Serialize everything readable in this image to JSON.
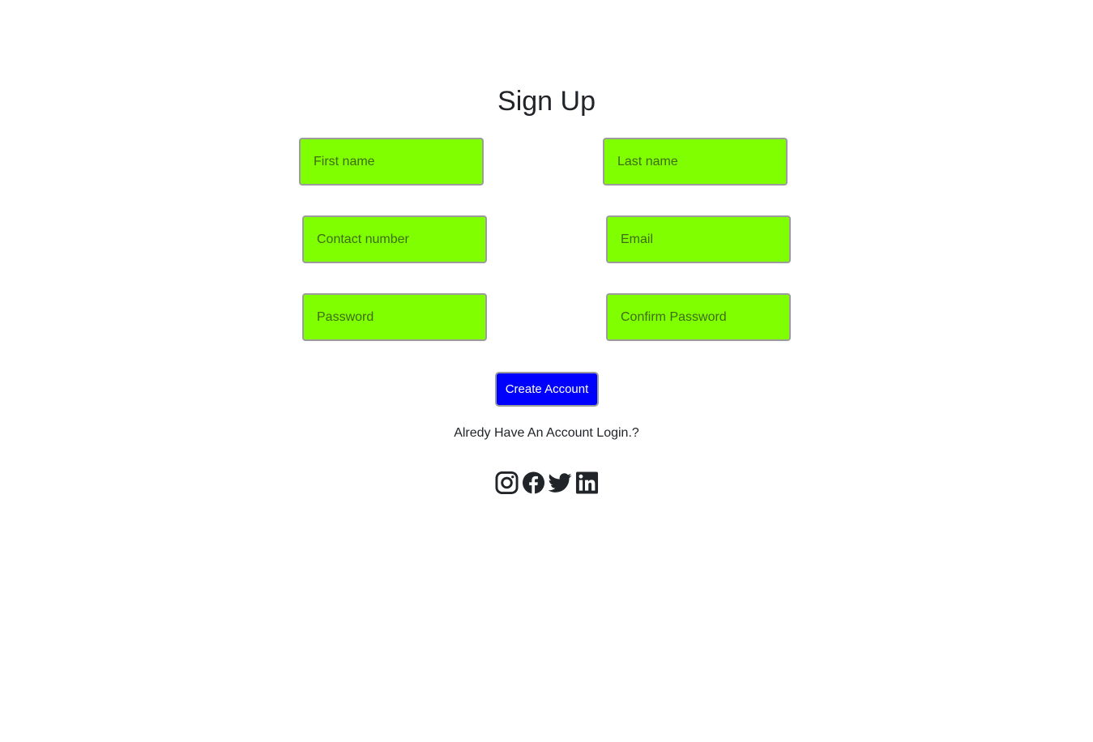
{
  "title": "Sign Up",
  "fields": {
    "first_name": {
      "placeholder": "First name",
      "value": ""
    },
    "last_name": {
      "placeholder": "Last name",
      "value": ""
    },
    "contact_number": {
      "placeholder": "Contact number",
      "value": ""
    },
    "email": {
      "placeholder": "Email",
      "value": ""
    },
    "password": {
      "placeholder": "Password",
      "value": ""
    },
    "confirm_password": {
      "placeholder": "Confirm Password",
      "value": ""
    }
  },
  "create_button_label": "Create Account",
  "login_link_text": "Alredy Have An Account Login.?",
  "social_icons": [
    "instagram-icon",
    "facebook-icon",
    "twitter-icon",
    "linkedin-icon"
  ],
  "colors": {
    "field_background": "#7fff00",
    "button_background": "#0000ff",
    "button_text": "#ffffff",
    "text": "#212529"
  }
}
